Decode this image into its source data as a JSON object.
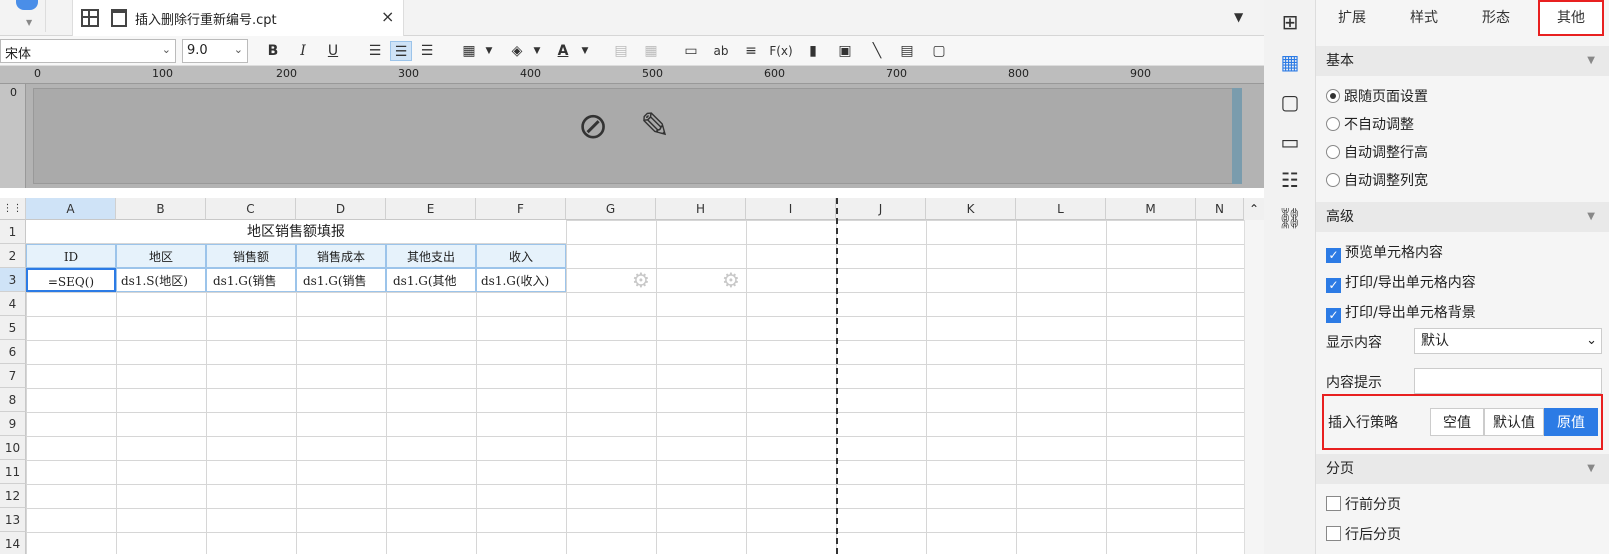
{
  "tab": {
    "title": "插入删除行重新编号.cpt",
    "close": "×",
    "menu": "▼"
  },
  "toolbar": {
    "font": "宋体",
    "size": "9.0",
    "bold": "B",
    "italic": "I",
    "underline": "U",
    "text_ab": "ab",
    "formula": "F(x)"
  },
  "ruler": {
    "ticks": [
      "0",
      "100",
      "200",
      "300",
      "400",
      "500",
      "600",
      "700",
      "800",
      "900"
    ],
    "vzero": "0"
  },
  "sheet": {
    "columns": [
      "A",
      "B",
      "C",
      "D",
      "E",
      "F",
      "G",
      "H",
      "I",
      "J",
      "K",
      "L",
      "M",
      "N"
    ],
    "rows": [
      "1",
      "2",
      "3",
      "4",
      "5",
      "6",
      "7",
      "8",
      "9",
      "10",
      "11",
      "12",
      "13",
      "14"
    ],
    "title": "地区销售额填报",
    "headers": [
      "ID",
      "地区",
      "销售额",
      "销售成本",
      "其他支出",
      "收入"
    ],
    "formulas": [
      "=SEQ()",
      "ds1.S(地区)",
      "ds1.G(销售",
      "ds1.G(销售",
      "ds1.G(其他",
      "ds1.G(收入)"
    ]
  },
  "iconbar": {
    "items": [
      "cell-element-icon",
      "cell-attribute-icon",
      "widget-icon",
      "data-column-icon",
      "condition-icon",
      "hyperlink-icon"
    ]
  },
  "panel": {
    "tabs": [
      "扩展",
      "样式",
      "形态",
      "其他"
    ],
    "active_tab": "其他",
    "basic": {
      "title": "基本",
      "options": [
        "跟随页面设置",
        "不自动调整",
        "自动调整行高",
        "自动调整列宽"
      ],
      "selected": "跟随页面设置"
    },
    "advanced": {
      "title": "高级",
      "checks": [
        "预览单元格内容",
        "打印/导出单元格内容",
        "打印/导出单元格背景"
      ],
      "display_label": "显示内容",
      "display_value": "默认",
      "tooltip_label": "内容提示",
      "tooltip_value": "",
      "strategy_label": "插入行策略",
      "strategy_options": [
        "空值",
        "默认值",
        "原值"
      ],
      "strategy_selected": "原值"
    },
    "paging": {
      "title": "分页",
      "checks": [
        "行前分页",
        "行后分页"
      ]
    }
  },
  "colors": {
    "accent": "#2c7be5",
    "highlight": "#e82020"
  }
}
